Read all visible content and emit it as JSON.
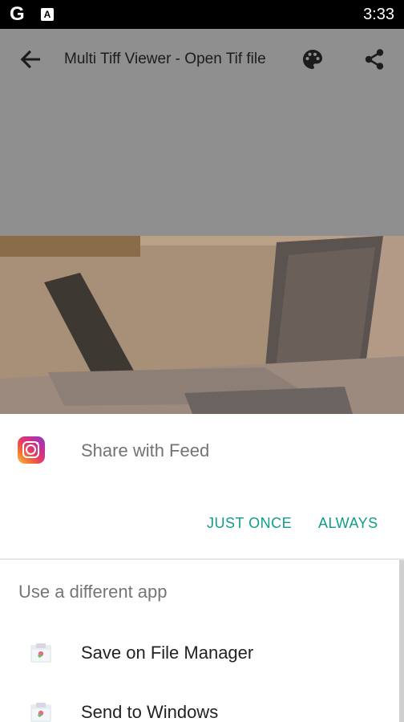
{
  "status_bar": {
    "left_icon_g": "G",
    "left_icon_a": "A",
    "time": "3:33"
  },
  "toolbar": {
    "title": "Multi Tiff Viewer - Open Tif file",
    "icons": [
      "back-arrow-icon",
      "palette-icon",
      "share-icon"
    ]
  },
  "sheet": {
    "suggested_app": {
      "icon": "instagram-icon",
      "label": "Share with Feed"
    },
    "just_once_label": "JUST ONCE",
    "always_label": "ALWAYS",
    "accent_color": "#0f9d8a",
    "other_apps_heading": "Use a different app",
    "apps": [
      {
        "icon": "app-icon",
        "label": "Save on File Manager"
      },
      {
        "icon": "app-icon",
        "label": "Send to Windows"
      }
    ]
  }
}
